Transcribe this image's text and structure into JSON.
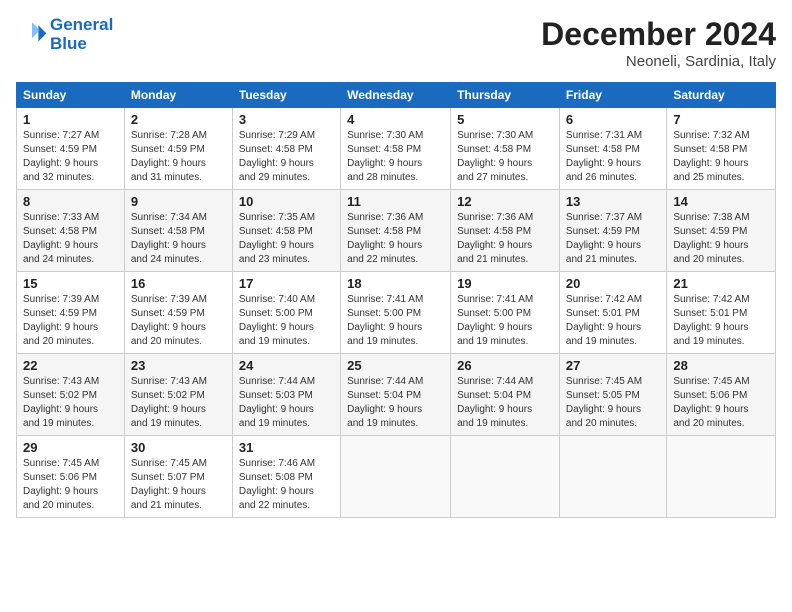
{
  "header": {
    "logo_line1": "General",
    "logo_line2": "Blue",
    "month": "December 2024",
    "location": "Neoneli, Sardinia, Italy"
  },
  "weekdays": [
    "Sunday",
    "Monday",
    "Tuesday",
    "Wednesday",
    "Thursday",
    "Friday",
    "Saturday"
  ],
  "weeks": [
    [
      {
        "day": "1",
        "info": "Sunrise: 7:27 AM\nSunset: 4:59 PM\nDaylight: 9 hours\nand 32 minutes."
      },
      {
        "day": "2",
        "info": "Sunrise: 7:28 AM\nSunset: 4:59 PM\nDaylight: 9 hours\nand 31 minutes."
      },
      {
        "day": "3",
        "info": "Sunrise: 7:29 AM\nSunset: 4:58 PM\nDaylight: 9 hours\nand 29 minutes."
      },
      {
        "day": "4",
        "info": "Sunrise: 7:30 AM\nSunset: 4:58 PM\nDaylight: 9 hours\nand 28 minutes."
      },
      {
        "day": "5",
        "info": "Sunrise: 7:30 AM\nSunset: 4:58 PM\nDaylight: 9 hours\nand 27 minutes."
      },
      {
        "day": "6",
        "info": "Sunrise: 7:31 AM\nSunset: 4:58 PM\nDaylight: 9 hours\nand 26 minutes."
      },
      {
        "day": "7",
        "info": "Sunrise: 7:32 AM\nSunset: 4:58 PM\nDaylight: 9 hours\nand 25 minutes."
      }
    ],
    [
      {
        "day": "8",
        "info": "Sunrise: 7:33 AM\nSunset: 4:58 PM\nDaylight: 9 hours\nand 24 minutes."
      },
      {
        "day": "9",
        "info": "Sunrise: 7:34 AM\nSunset: 4:58 PM\nDaylight: 9 hours\nand 24 minutes."
      },
      {
        "day": "10",
        "info": "Sunrise: 7:35 AM\nSunset: 4:58 PM\nDaylight: 9 hours\nand 23 minutes."
      },
      {
        "day": "11",
        "info": "Sunrise: 7:36 AM\nSunset: 4:58 PM\nDaylight: 9 hours\nand 22 minutes."
      },
      {
        "day": "12",
        "info": "Sunrise: 7:36 AM\nSunset: 4:58 PM\nDaylight: 9 hours\nand 21 minutes."
      },
      {
        "day": "13",
        "info": "Sunrise: 7:37 AM\nSunset: 4:59 PM\nDaylight: 9 hours\nand 21 minutes."
      },
      {
        "day": "14",
        "info": "Sunrise: 7:38 AM\nSunset: 4:59 PM\nDaylight: 9 hours\nand 20 minutes."
      }
    ],
    [
      {
        "day": "15",
        "info": "Sunrise: 7:39 AM\nSunset: 4:59 PM\nDaylight: 9 hours\nand 20 minutes."
      },
      {
        "day": "16",
        "info": "Sunrise: 7:39 AM\nSunset: 4:59 PM\nDaylight: 9 hours\nand 20 minutes."
      },
      {
        "day": "17",
        "info": "Sunrise: 7:40 AM\nSunset: 5:00 PM\nDaylight: 9 hours\nand 19 minutes."
      },
      {
        "day": "18",
        "info": "Sunrise: 7:41 AM\nSunset: 5:00 PM\nDaylight: 9 hours\nand 19 minutes."
      },
      {
        "day": "19",
        "info": "Sunrise: 7:41 AM\nSunset: 5:00 PM\nDaylight: 9 hours\nand 19 minutes."
      },
      {
        "day": "20",
        "info": "Sunrise: 7:42 AM\nSunset: 5:01 PM\nDaylight: 9 hours\nand 19 minutes."
      },
      {
        "day": "21",
        "info": "Sunrise: 7:42 AM\nSunset: 5:01 PM\nDaylight: 9 hours\nand 19 minutes."
      }
    ],
    [
      {
        "day": "22",
        "info": "Sunrise: 7:43 AM\nSunset: 5:02 PM\nDaylight: 9 hours\nand 19 minutes."
      },
      {
        "day": "23",
        "info": "Sunrise: 7:43 AM\nSunset: 5:02 PM\nDaylight: 9 hours\nand 19 minutes."
      },
      {
        "day": "24",
        "info": "Sunrise: 7:44 AM\nSunset: 5:03 PM\nDaylight: 9 hours\nand 19 minutes."
      },
      {
        "day": "25",
        "info": "Sunrise: 7:44 AM\nSunset: 5:04 PM\nDaylight: 9 hours\nand 19 minutes."
      },
      {
        "day": "26",
        "info": "Sunrise: 7:44 AM\nSunset: 5:04 PM\nDaylight: 9 hours\nand 19 minutes."
      },
      {
        "day": "27",
        "info": "Sunrise: 7:45 AM\nSunset: 5:05 PM\nDaylight: 9 hours\nand 20 minutes."
      },
      {
        "day": "28",
        "info": "Sunrise: 7:45 AM\nSunset: 5:06 PM\nDaylight: 9 hours\nand 20 minutes."
      }
    ],
    [
      {
        "day": "29",
        "info": "Sunrise: 7:45 AM\nSunset: 5:06 PM\nDaylight: 9 hours\nand 20 minutes."
      },
      {
        "day": "30",
        "info": "Sunrise: 7:45 AM\nSunset: 5:07 PM\nDaylight: 9 hours\nand 21 minutes."
      },
      {
        "day": "31",
        "info": "Sunrise: 7:46 AM\nSunset: 5:08 PM\nDaylight: 9 hours\nand 22 minutes."
      },
      null,
      null,
      null,
      null
    ]
  ]
}
